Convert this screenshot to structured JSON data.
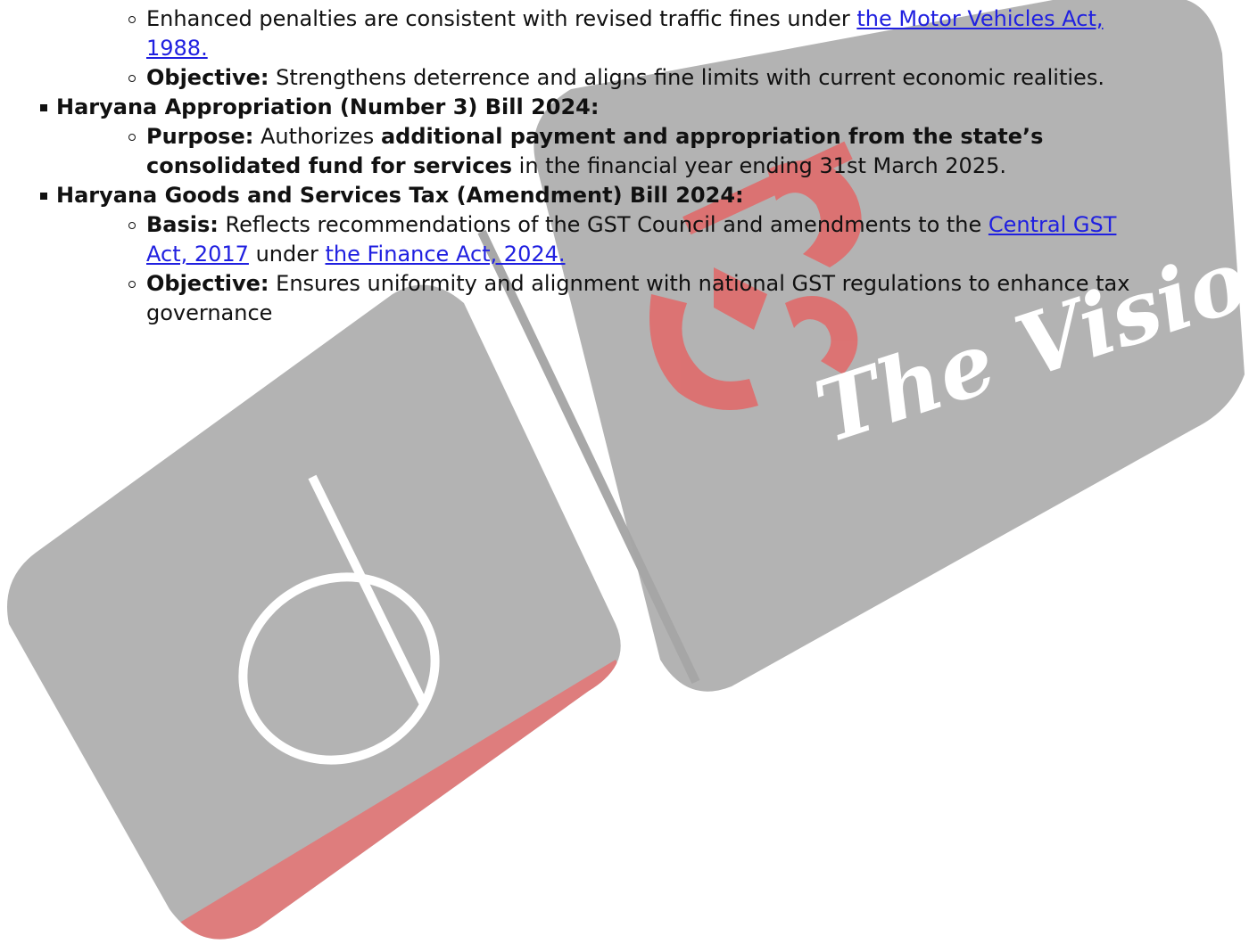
{
  "items": {
    "partial_top_line": "",
    "motor": {
      "line1": "Enhanced penalties are consistent with revised traffic fines under ",
      "link": "the Motor Vehicles Act,",
      "link2": "1988."
    },
    "objective1": {
      "label": "Objective:",
      "text": " Strengthens deterrence and aligns fine limits with current economic realities."
    },
    "appropriation": {
      "title": "Haryana Appropriation (Number 3) Bill 2024:",
      "purpose_label": "Purpose:",
      "purpose_text1": " Authorizes ",
      "purpose_bold1": "additional payment and appropriation from the state’s",
      "purpose_bold2": "consolidated fund for services",
      "purpose_text2": " in the financial year ending 31st March 2025."
    },
    "gst": {
      "title": "Haryana Goods and Services Tax (Amendment) Bill 2024:",
      "basis_label": "Basis:",
      "basis_text": " Reflects recommendations of the GST Council and amendments to the ",
      "basis_link1a": "Central GST",
      "basis_link1b": "Act, 2017",
      "basis_under": " under ",
      "basis_link2": "the Finance Act, 2024.",
      "objective_label": "Objective:",
      "objective_text1": " Ensures uniformity and alignment with national GST regulations to enhance tax",
      "objective_text2": "governance"
    }
  },
  "watermark": {
    "brand_text": "The Vision",
    "colors": {
      "gray": "#9a9a9a",
      "red": "#e06666"
    }
  }
}
